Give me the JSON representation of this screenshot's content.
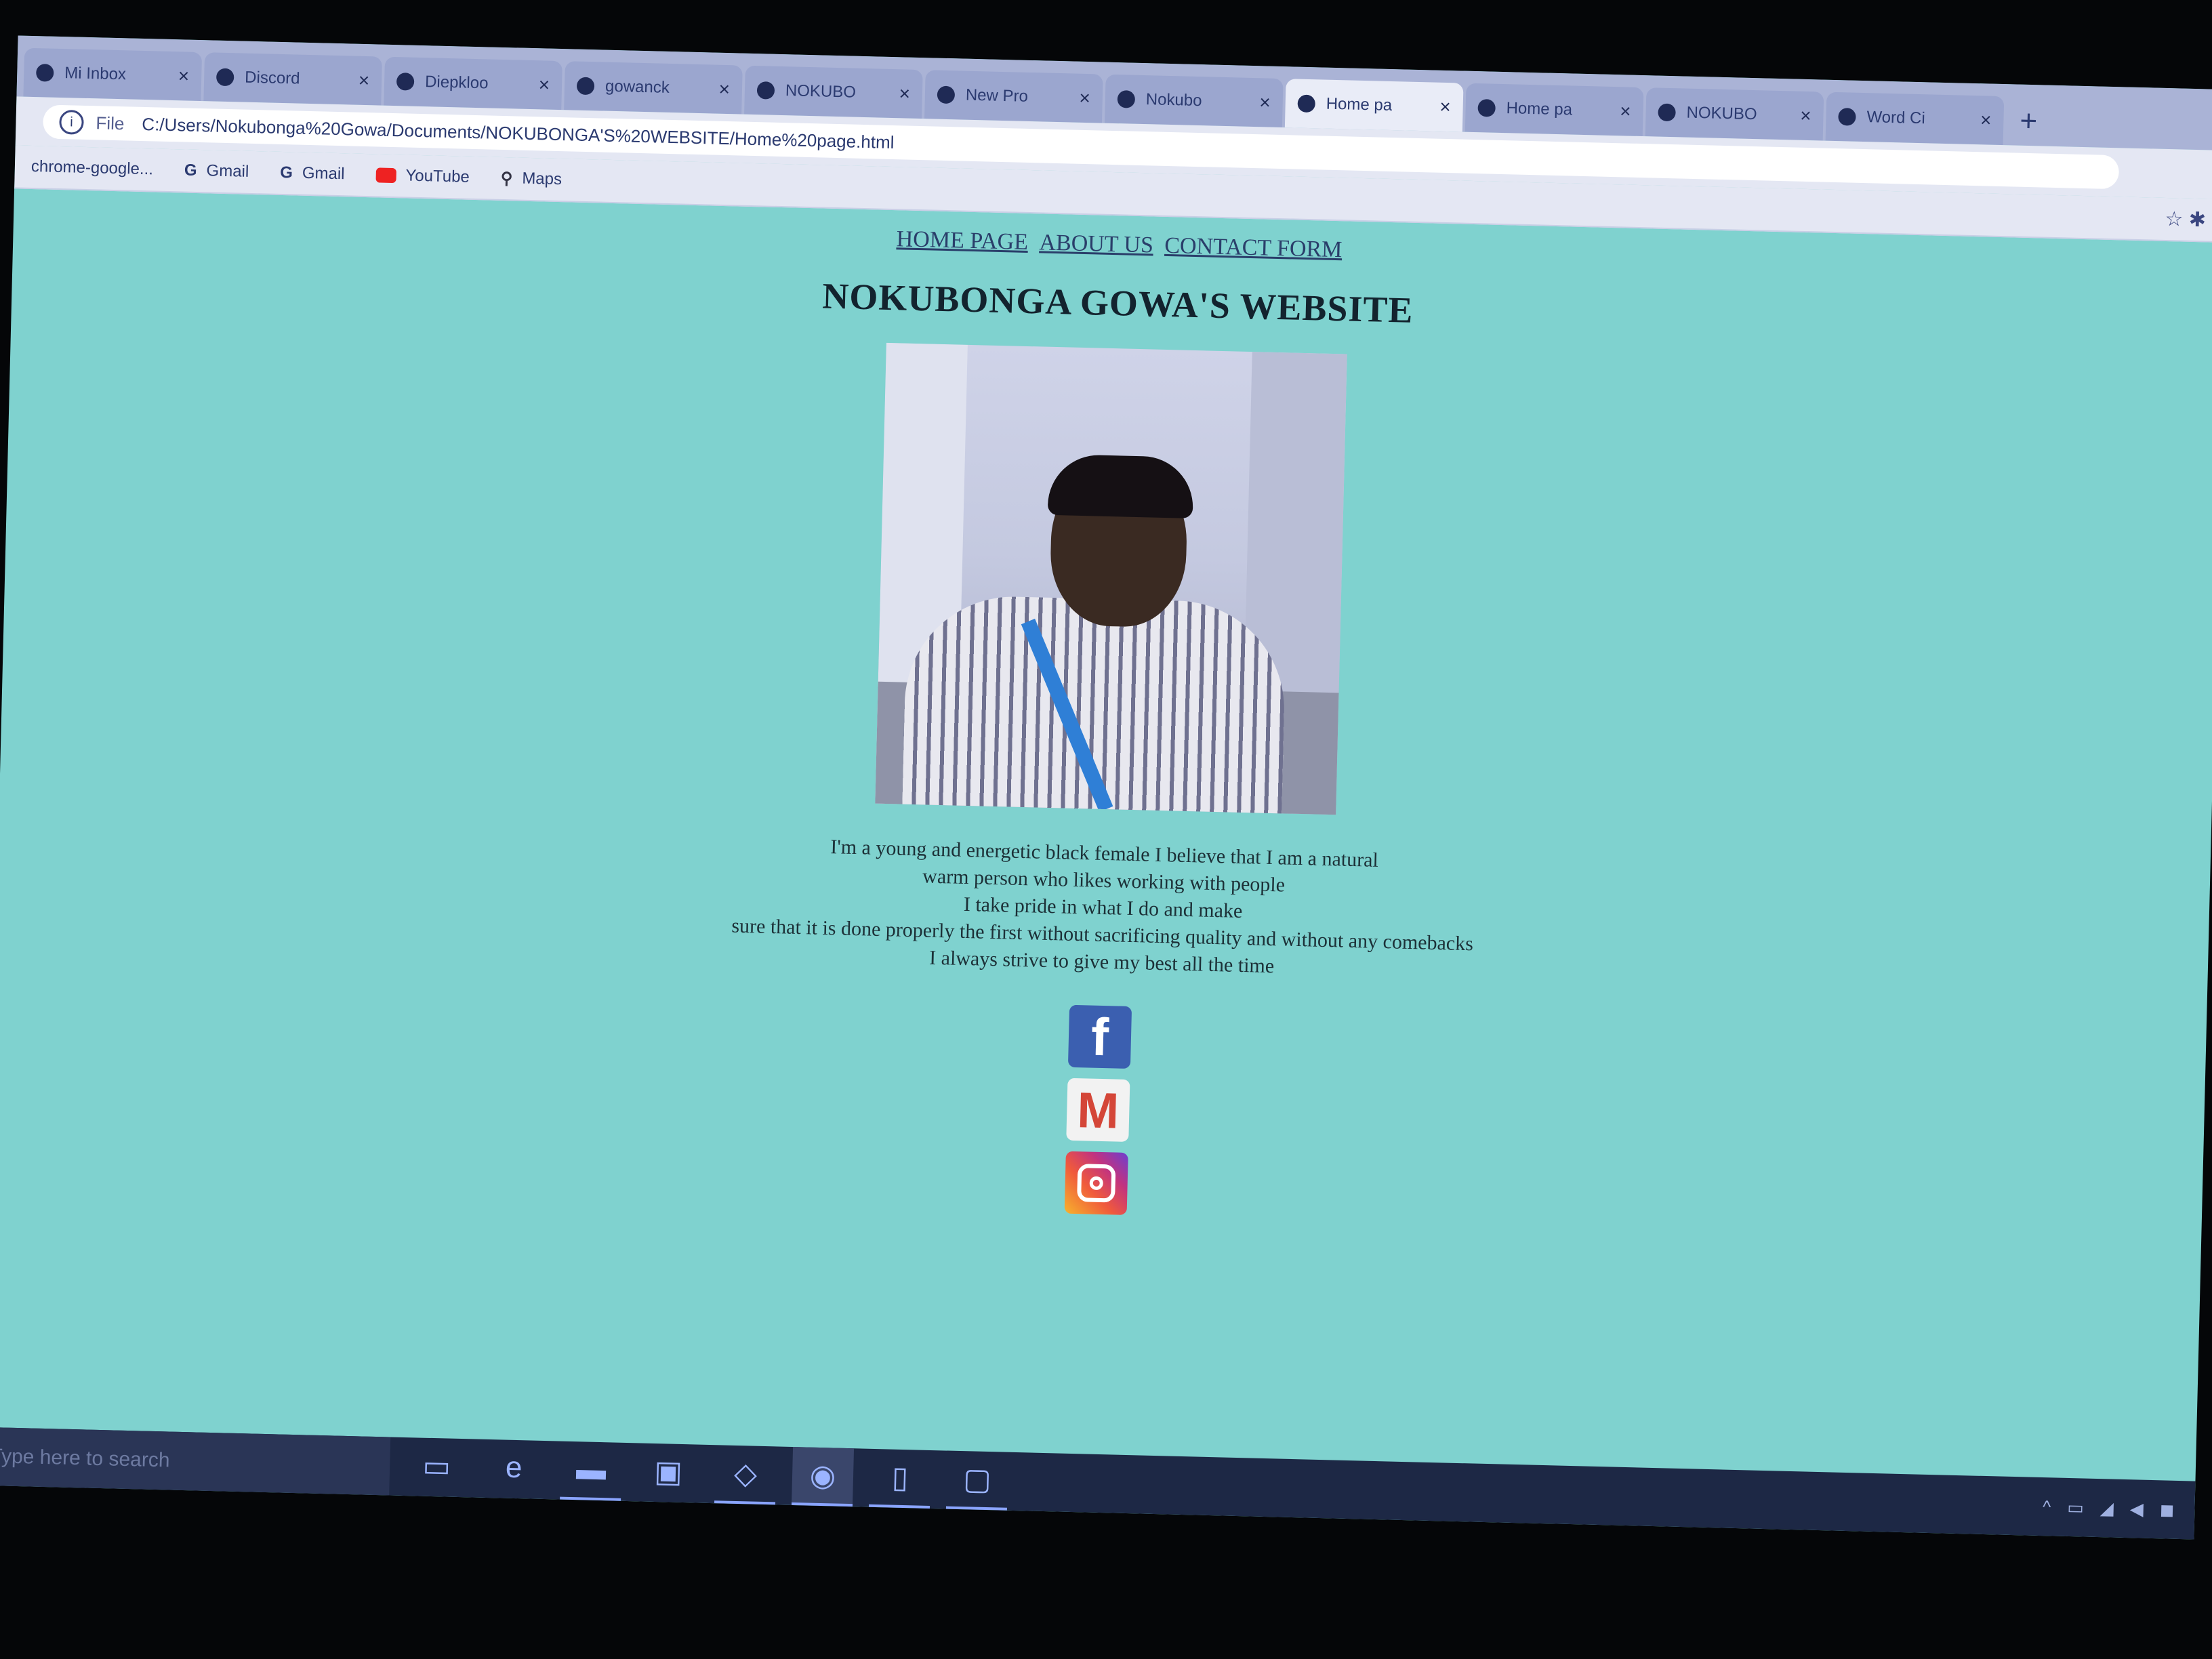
{
  "browser": {
    "tabs": [
      {
        "label": "Mi Inbox",
        "active": false
      },
      {
        "label": "Discord",
        "active": false
      },
      {
        "label": "Diepkloo",
        "active": false
      },
      {
        "label": "gowanck",
        "active": false
      },
      {
        "label": "NOKUBO",
        "active": false
      },
      {
        "label": "New Pro",
        "active": false
      },
      {
        "label": "Nokubo",
        "active": false
      },
      {
        "label": "Home pa",
        "active": true
      },
      {
        "label": "Home pa",
        "active": false
      },
      {
        "label": "NOKUBO",
        "active": false
      },
      {
        "label": "Word Ci",
        "active": false
      }
    ],
    "new_tab_symbol": "+",
    "close_symbol": "×",
    "address": {
      "scheme": "File",
      "url": "C:/Users/Nokubonga%20Gowa/Documents/NOKUBONGA'S%20WEBSITE/Home%20page.html"
    },
    "bookmarks": [
      {
        "label": "chrome-google...",
        "icon": "chrome-icon"
      },
      {
        "label": "Gmail",
        "icon": "google-icon"
      },
      {
        "label": "Gmail",
        "icon": "google-icon"
      },
      {
        "label": "YouTube",
        "icon": "youtube-icon"
      },
      {
        "label": "Maps",
        "icon": "maps-pin-icon"
      }
    ]
  },
  "page": {
    "nav": [
      "HOME PAGE",
      "ABOUT US",
      "CONTACT FORM"
    ],
    "title": "NOKUBONGA GOWA'S WEBSITE",
    "bio_lines": [
      "I'm a young and energetic black female I believe that I am a natural",
      "warm person who likes working with people",
      "I take pride in what I do and make",
      "sure that it is done properly the first without sacrificing quality and without any comebacks",
      "I always strive to give my best all the time"
    ],
    "social_icons": [
      {
        "name": "facebook-icon",
        "glyph": "f"
      },
      {
        "name": "gmail-icon",
        "glyph": "M"
      },
      {
        "name": "instagram-icon",
        "glyph": ""
      }
    ]
  },
  "taskbar": {
    "search_placeholder": "Type here to search",
    "apps": [
      {
        "name": "task-view-icon",
        "glyph": "▭",
        "state": ""
      },
      {
        "name": "edge-icon",
        "glyph": "e",
        "state": ""
      },
      {
        "name": "file-explorer-icon",
        "glyph": "▬",
        "state": "open"
      },
      {
        "name": "store-icon",
        "glyph": "▣",
        "state": ""
      },
      {
        "name": "vscode-icon",
        "glyph": "◇",
        "state": "open"
      },
      {
        "name": "chrome-icon",
        "glyph": "◉",
        "state": "active"
      },
      {
        "name": "notepad-icon",
        "glyph": "▯",
        "state": "open"
      },
      {
        "name": "window-icon",
        "glyph": "▢",
        "state": "open"
      }
    ],
    "tray": [
      "^",
      "▭",
      "◢",
      "◀",
      "◼"
    ]
  },
  "colors": {
    "page_background": "#7fd2cf",
    "taskbar": "#1d2845"
  }
}
